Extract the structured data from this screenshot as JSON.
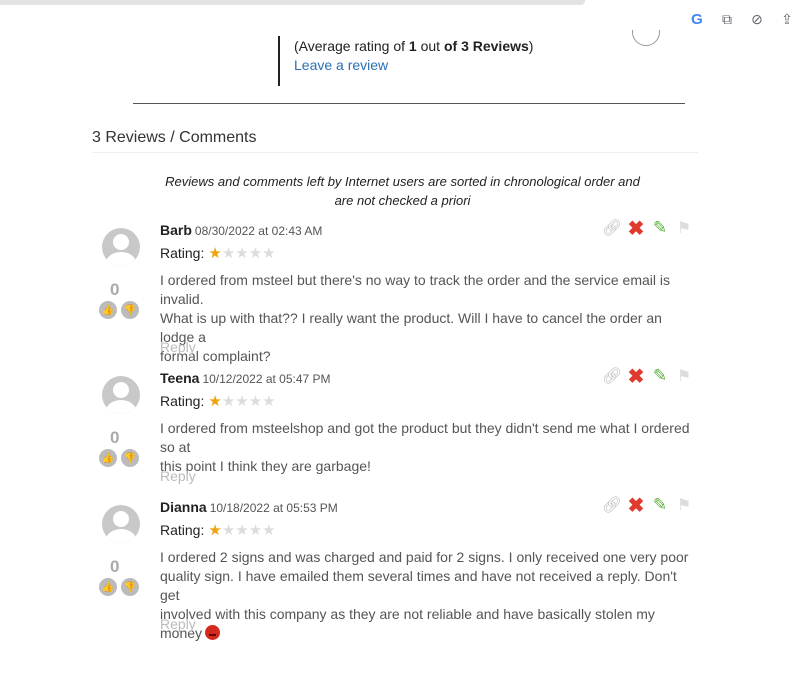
{
  "summary": {
    "avg_prefix": "(Average rating of ",
    "avg_value": "1",
    "avg_mid": " out ",
    "avg_of": "of 3 Reviews",
    "avg_suffix": ")",
    "leave_review": "Leave a review"
  },
  "section": {
    "title": "3 Reviews / Comments",
    "notice_line1": "Reviews and comments left by Internet users are sorted in chronological order and",
    "notice_line2": "are not checked a priori"
  },
  "labels": {
    "rating": "Rating:",
    "reply": "Reply"
  },
  "reviews": [
    {
      "name": "Barb",
      "date": "08/30/2022 at 02:43 AM",
      "rating": 1,
      "votes": "0",
      "text1": "I ordered from msteel but there's no way to track the order and the service email is invalid.",
      "text2": "What is up with that?? I really want the product. Will I have to cancel the order an lodge a",
      "text3": "formal complaint?"
    },
    {
      "name": "Teena",
      "date": "10/12/2022 at 05:47 PM",
      "rating": 1,
      "votes": "0",
      "text1": "I ordered from msteelshop and got the product but they didn't send me what I ordered so at",
      "text2": "this point I think they are garbage!"
    },
    {
      "name": "Dianna",
      "date": "10/18/2022 at 05:53 PM",
      "rating": 1,
      "votes": "0",
      "text1": "I ordered 2 signs and was charged and paid for 2 signs. I only received one very poor",
      "text2": "quality sign. I have emailed them several times and have not received a reply. Don't get",
      "text3": "involved with this company as they are not reliable and have basically stolen my money"
    }
  ],
  "colors": {
    "link": "#2a6fb5",
    "star_on": "#f0a30a",
    "delete": "#e03a2f",
    "edit": "#5fae3e"
  },
  "icons": [
    "google-icon",
    "translate-icon",
    "eye-off-icon",
    "share-icon",
    "link-icon",
    "delete-icon",
    "edit-icon",
    "flag-icon",
    "thumbs-up-icon",
    "thumbs-down-icon",
    "star-icon",
    "angry-emoji-icon"
  ]
}
